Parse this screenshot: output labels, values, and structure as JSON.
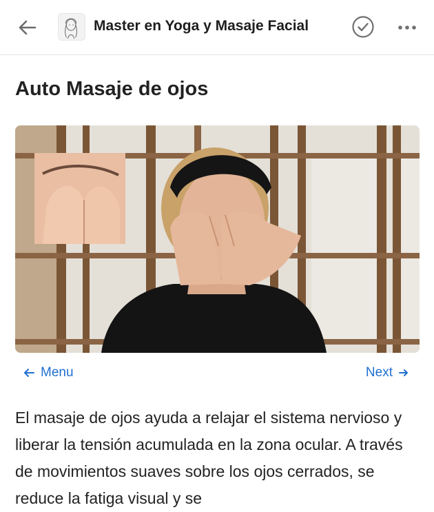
{
  "header": {
    "back_icon": "arrow-left-icon",
    "title": "Master en Yoga y Masaje Facial",
    "complete_icon": "check-circle-icon",
    "more_icon": "more-dots-icon"
  },
  "lesson": {
    "title": "Auto Masaje de ojos",
    "video_icon": "video-thumbnail"
  },
  "nav": {
    "menu_label": "Menu",
    "next_label": "Next"
  },
  "content": {
    "paragraph": "El masaje de ojos ayuda a relajar el sistema nervioso y liberar la tensión acumulada en la zona ocular. A través de movimientos suaves sobre los ojos cerrados, se reduce la fatiga visual y se"
  },
  "colors": {
    "link": "#1f6fd0",
    "text": "#232323"
  }
}
